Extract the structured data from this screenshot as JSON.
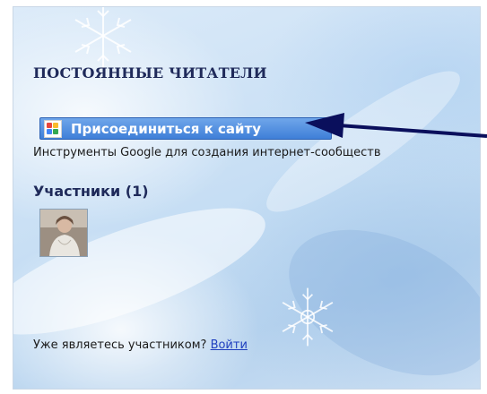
{
  "widget": {
    "heading": "ПОСТОЯННЫЕ ЧИТАТЕЛИ",
    "join_button_label": "Присоединиться к сайту",
    "description": "Инструменты Google для создания интернет-сообществ",
    "members_label": "Участники (1)",
    "login_prompt": "Уже являетесь участником?",
    "login_link": "Войти"
  },
  "colors": {
    "accent_button": "#3f7fd8",
    "heading": "#1f2a5a",
    "link": "#1f3fbf",
    "arrow": "#0a0f5c"
  },
  "icons": [
    "google-friend-connect-icon",
    "snowflake-icon",
    "arrow-icon"
  ]
}
